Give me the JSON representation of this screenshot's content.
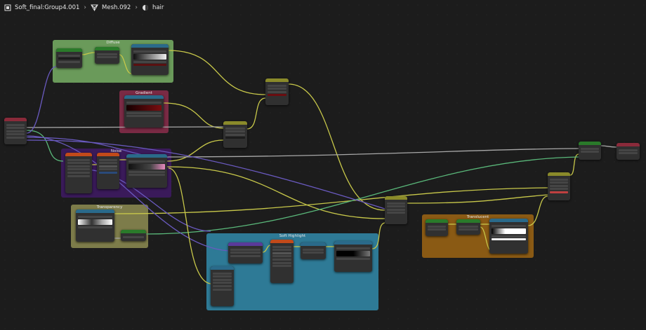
{
  "breadcrumb": {
    "object": "Soft_final:Group4.001",
    "mesh": "Mesh.092",
    "material": "hair"
  },
  "frames": {
    "diffuse": "Diffuse",
    "gradient": "Gradient",
    "noise": "Noise",
    "transparency": "Transparency",
    "soft_highlight": "Soft Highlight",
    "translucent": "Translucent"
  },
  "colors": {
    "diffuse_frame": "#6a9a5a",
    "gradient_frame": "#7a2a44",
    "noise_frame": "#3a1a5a",
    "transparency_frame": "#7d7c4a",
    "soft_highlight_frame": "#2e7a96",
    "translucent_frame": "#8a5a14",
    "wire_yellow": "#c8c84a",
    "wire_gray": "#a8a8a8",
    "wire_purple": "#6a5ac0",
    "wire_green": "#5ab87a",
    "header_input": "#8a2a3a",
    "header_texture": "#c24a1a",
    "header_converter": "#2a6a8a",
    "header_shader": "#2a7a2a",
    "header_vector": "#5a3a9a",
    "header_color": "#8a8a2a"
  },
  "icons": {
    "object": "object-icon",
    "mesh": "mesh-icon",
    "material": "material-icon",
    "separator": "chevron-right-icon"
  }
}
